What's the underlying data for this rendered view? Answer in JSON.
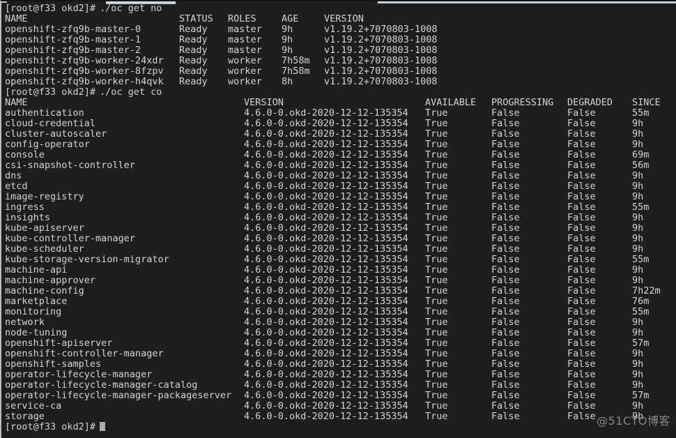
{
  "terminal": {
    "background_color": "#1e1e1e",
    "foreground_color": "#d4d4d4",
    "prompt": "[root@f33 okd2]# ",
    "cursor_glyph": "block-cursor"
  },
  "watermark": {
    "text": "@51CTO博客"
  },
  "command_1": {
    "prompt": "[root@f33 okd2]# ",
    "command": "./oc get no"
  },
  "nodes_table": {
    "headers": {
      "name": "NAME",
      "status": "STATUS",
      "roles": "ROLES",
      "age": "AGE",
      "version": "VERSION"
    },
    "rows": [
      {
        "name": "openshift-zfq9b-master-0",
        "status": "Ready",
        "roles": "master",
        "age": "9h",
        "version": "v1.19.2+7070803-1008"
      },
      {
        "name": "openshift-zfq9b-master-1",
        "status": "Ready",
        "roles": "master",
        "age": "9h",
        "version": "v1.19.2+7070803-1008"
      },
      {
        "name": "openshift-zfq9b-master-2",
        "status": "Ready",
        "roles": "master",
        "age": "9h",
        "version": "v1.19.2+7070803-1008"
      },
      {
        "name": "openshift-zfq9b-worker-24xdr",
        "status": "Ready",
        "roles": "worker",
        "age": "7h58m",
        "version": "v1.19.2+7070803-1008"
      },
      {
        "name": "openshift-zfq9b-worker-8fzpv",
        "status": "Ready",
        "roles": "worker",
        "age": "7h58m",
        "version": "v1.19.2+7070803-1008"
      },
      {
        "name": "openshift-zfq9b-worker-h4qvk",
        "status": "Ready",
        "roles": "worker",
        "age": "8h",
        "version": "v1.19.2+7070803-1008"
      }
    ]
  },
  "command_2": {
    "prompt": "[root@f33 okd2]# ",
    "command": "./oc get co"
  },
  "operators_table": {
    "headers": {
      "name": "NAME",
      "version": "VERSION",
      "available": "AVAILABLE",
      "progressing": "PROGRESSING",
      "degraded": "DEGRADED",
      "since": "SINCE"
    },
    "rows": [
      {
        "name": "authentication",
        "version": "4.6.0-0.okd-2020-12-12-135354",
        "available": "True",
        "progressing": "False",
        "degraded": "False",
        "since": "55m"
      },
      {
        "name": "cloud-credential",
        "version": "4.6.0-0.okd-2020-12-12-135354",
        "available": "True",
        "progressing": "False",
        "degraded": "False",
        "since": "9h"
      },
      {
        "name": "cluster-autoscaler",
        "version": "4.6.0-0.okd-2020-12-12-135354",
        "available": "True",
        "progressing": "False",
        "degraded": "False",
        "since": "9h"
      },
      {
        "name": "config-operator",
        "version": "4.6.0-0.okd-2020-12-12-135354",
        "available": "True",
        "progressing": "False",
        "degraded": "False",
        "since": "9h"
      },
      {
        "name": "console",
        "version": "4.6.0-0.okd-2020-12-12-135354",
        "available": "True",
        "progressing": "False",
        "degraded": "False",
        "since": "69m"
      },
      {
        "name": "csi-snapshot-controller",
        "version": "4.6.0-0.okd-2020-12-12-135354",
        "available": "True",
        "progressing": "False",
        "degraded": "False",
        "since": "56m"
      },
      {
        "name": "dns",
        "version": "4.6.0-0.okd-2020-12-12-135354",
        "available": "True",
        "progressing": "False",
        "degraded": "False",
        "since": "9h"
      },
      {
        "name": "etcd",
        "version": "4.6.0-0.okd-2020-12-12-135354",
        "available": "True",
        "progressing": "False",
        "degraded": "False",
        "since": "9h"
      },
      {
        "name": "image-registry",
        "version": "4.6.0-0.okd-2020-12-12-135354",
        "available": "True",
        "progressing": "False",
        "degraded": "False",
        "since": "9h"
      },
      {
        "name": "ingress",
        "version": "4.6.0-0.okd-2020-12-12-135354",
        "available": "True",
        "progressing": "False",
        "degraded": "False",
        "since": "55m"
      },
      {
        "name": "insights",
        "version": "4.6.0-0.okd-2020-12-12-135354",
        "available": "True",
        "progressing": "False",
        "degraded": "False",
        "since": "9h"
      },
      {
        "name": "kube-apiserver",
        "version": "4.6.0-0.okd-2020-12-12-135354",
        "available": "True",
        "progressing": "False",
        "degraded": "False",
        "since": "9h"
      },
      {
        "name": "kube-controller-manager",
        "version": "4.6.0-0.okd-2020-12-12-135354",
        "available": "True",
        "progressing": "False",
        "degraded": "False",
        "since": "9h"
      },
      {
        "name": "kube-scheduler",
        "version": "4.6.0-0.okd-2020-12-12-135354",
        "available": "True",
        "progressing": "False",
        "degraded": "False",
        "since": "9h"
      },
      {
        "name": "kube-storage-version-migrator",
        "version": "4.6.0-0.okd-2020-12-12-135354",
        "available": "True",
        "progressing": "False",
        "degraded": "False",
        "since": "55m"
      },
      {
        "name": "machine-api",
        "version": "4.6.0-0.okd-2020-12-12-135354",
        "available": "True",
        "progressing": "False",
        "degraded": "False",
        "since": "9h"
      },
      {
        "name": "machine-approver",
        "version": "4.6.0-0.okd-2020-12-12-135354",
        "available": "True",
        "progressing": "False",
        "degraded": "False",
        "since": "9h"
      },
      {
        "name": "machine-config",
        "version": "4.6.0-0.okd-2020-12-12-135354",
        "available": "True",
        "progressing": "False",
        "degraded": "False",
        "since": "7h22m"
      },
      {
        "name": "marketplace",
        "version": "4.6.0-0.okd-2020-12-12-135354",
        "available": "True",
        "progressing": "False",
        "degraded": "False",
        "since": "76m"
      },
      {
        "name": "monitoring",
        "version": "4.6.0-0.okd-2020-12-12-135354",
        "available": "True",
        "progressing": "False",
        "degraded": "False",
        "since": "55m"
      },
      {
        "name": "network",
        "version": "4.6.0-0.okd-2020-12-12-135354",
        "available": "True",
        "progressing": "False",
        "degraded": "False",
        "since": "9h"
      },
      {
        "name": "node-tuning",
        "version": "4.6.0-0.okd-2020-12-12-135354",
        "available": "True",
        "progressing": "False",
        "degraded": "False",
        "since": "9h"
      },
      {
        "name": "openshift-apiserver",
        "version": "4.6.0-0.okd-2020-12-12-135354",
        "available": "True",
        "progressing": "False",
        "degraded": "False",
        "since": "57m"
      },
      {
        "name": "openshift-controller-manager",
        "version": "4.6.0-0.okd-2020-12-12-135354",
        "available": "True",
        "progressing": "False",
        "degraded": "False",
        "since": "9h"
      },
      {
        "name": "openshift-samples",
        "version": "4.6.0-0.okd-2020-12-12-135354",
        "available": "True",
        "progressing": "False",
        "degraded": "False",
        "since": "9h"
      },
      {
        "name": "operator-lifecycle-manager",
        "version": "4.6.0-0.okd-2020-12-12-135354",
        "available": "True",
        "progressing": "False",
        "degraded": "False",
        "since": "9h"
      },
      {
        "name": "operator-lifecycle-manager-catalog",
        "version": "4.6.0-0.okd-2020-12-12-135354",
        "available": "True",
        "progressing": "False",
        "degraded": "False",
        "since": "9h"
      },
      {
        "name": "operator-lifecycle-manager-packageserver",
        "version": "4.6.0-0.okd-2020-12-12-135354",
        "available": "True",
        "progressing": "False",
        "degraded": "False",
        "since": "57m"
      },
      {
        "name": "service-ca",
        "version": "4.6.0-0.okd-2020-12-12-135354",
        "available": "True",
        "progressing": "False",
        "degraded": "False",
        "since": "9h"
      },
      {
        "name": "storage",
        "version": "4.6.0-0.okd-2020-12-12-135354",
        "available": "True",
        "progressing": "False",
        "degraded": "False",
        "since": "9h"
      }
    ]
  },
  "final_prompt": {
    "prompt": "[root@f33 okd2]# "
  }
}
